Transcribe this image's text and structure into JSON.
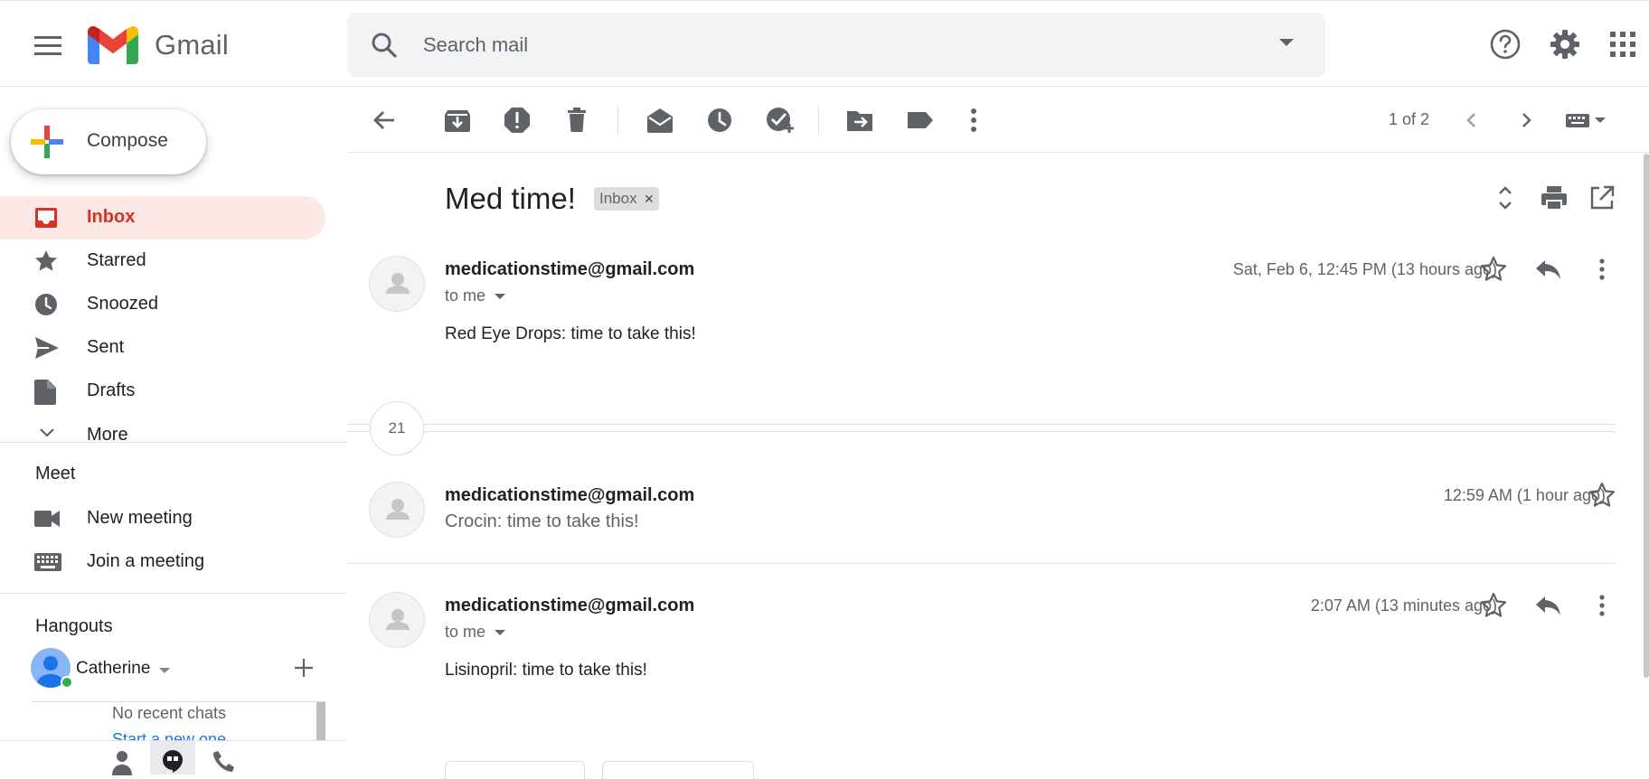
{
  "app": {
    "name": "Gmail"
  },
  "search": {
    "placeholder": "Search mail"
  },
  "compose": {
    "label": "Compose"
  },
  "nav": [
    {
      "label": "Inbox",
      "icon": "inbox-icon",
      "active": true
    },
    {
      "label": "Starred",
      "icon": "star-icon"
    },
    {
      "label": "Snoozed",
      "icon": "clock-icon"
    },
    {
      "label": "Sent",
      "icon": "send-icon"
    },
    {
      "label": "Drafts",
      "icon": "draft-icon"
    },
    {
      "label": "More",
      "icon": "chevron-down-icon"
    }
  ],
  "meet": {
    "title": "Meet",
    "items": [
      {
        "label": "New meeting",
        "icon": "video-icon"
      },
      {
        "label": "Join a meeting",
        "icon": "keyboard-icon"
      }
    ]
  },
  "hangouts": {
    "title": "Hangouts",
    "user": "Catherine",
    "no_chats": "No recent chats",
    "start_new": "Start a new one"
  },
  "toolbar": {
    "pager": "1 of 2"
  },
  "thread": {
    "subject": "Med time!",
    "label_chip": "Inbox",
    "collapsed_count": "21",
    "messages": [
      {
        "sender": "medicationstime@gmail.com",
        "to": "to me",
        "date": "Sat, Feb 6, 12:45 PM (13 hours ago)",
        "body": "Red Eye Drops: time to take this!"
      },
      {
        "sender": "medicationstime@gmail.com",
        "date": "12:59 AM (1 hour ago)",
        "snippet": "Crocin: time to take this!"
      },
      {
        "sender": "medicationstime@gmail.com",
        "to": "to me",
        "date": "2:07 AM (13 minutes ago)",
        "body": "Lisinopril: time to take this!"
      }
    ]
  },
  "colors": {
    "accent_red": "#d93025",
    "active_bg": "#fce8e6",
    "link_blue": "#1a73e8",
    "online_green": "#34a853"
  }
}
